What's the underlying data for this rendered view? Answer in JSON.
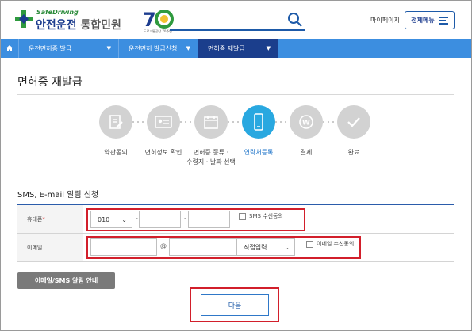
{
  "brand": {
    "sub": "SafeDriving",
    "name_main": "안전운전",
    "name_tail": "통합민원",
    "anniversary_caption": "도로교통공단 70주년"
  },
  "header": {
    "mypage_label": "마이페이지",
    "allmenu_label": "전체메뉴"
  },
  "nav": {
    "items": [
      {
        "label": "운전면허증 발급"
      },
      {
        "label": "운전면허 발급신청"
      },
      {
        "label": "면허증 재발급"
      }
    ]
  },
  "page": {
    "title": "면허증 재발급"
  },
  "steps": [
    {
      "label": "약관동의",
      "icon": "document-edit-icon"
    },
    {
      "label": "면허정보 확인",
      "icon": "license-card-icon"
    },
    {
      "label": "면허증 종류 · 수령지 · 날짜 선택",
      "line1": "면허증 종류 ·",
      "line2": "수령지 · 날짜 선택",
      "icon": "calendar-icon"
    },
    {
      "label": "연락처등록",
      "icon": "mobile-phone-icon",
      "active": true
    },
    {
      "label": "결제",
      "icon": "won-coin-icon"
    },
    {
      "label": "완료",
      "icon": "check-icon"
    }
  ],
  "section": {
    "title": "SMS, E-mail 알림 신청"
  },
  "form": {
    "phone": {
      "label": "휴대폰",
      "required_mark": "*",
      "prefix_value": "010",
      "separator": "-",
      "sms_consent_label": "SMS 수신동의"
    },
    "email": {
      "label": "이메일",
      "at": "@",
      "domain_select_value": "직접입력",
      "email_consent_label": "이메일 수신동의"
    }
  },
  "buttons": {
    "guide_label": "이메일/SMS 알림 안내",
    "next_label": "다음"
  },
  "colors": {
    "nav": "#3c8ee0",
    "nav_active": "#1b3e8c",
    "step_active": "#29a8e0",
    "highlight": "#d21f2b"
  }
}
